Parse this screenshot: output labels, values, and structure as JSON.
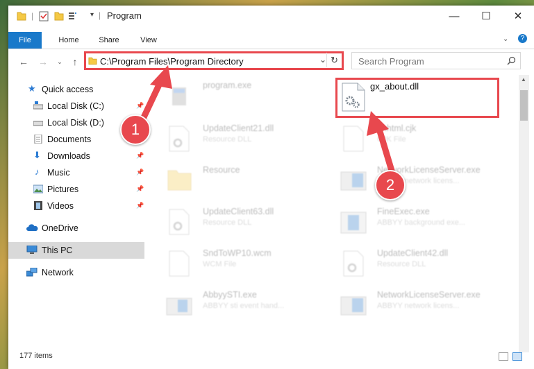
{
  "window": {
    "title": "Program"
  },
  "controls": {
    "minimize": "—",
    "maximize": "☐",
    "close": "✕",
    "help": "?"
  },
  "ribbon": {
    "tabs": [
      {
        "label": "File"
      },
      {
        "label": "Home"
      },
      {
        "label": "Share"
      },
      {
        "label": "View"
      }
    ]
  },
  "address": {
    "path": "C:\\Program Files\\Program Directory"
  },
  "search": {
    "placeholder": "Search Program"
  },
  "sidebar": {
    "items": [
      {
        "label": "Quick access"
      },
      {
        "label": "Local Disk (C:)"
      },
      {
        "label": "Local Disk (D:)"
      },
      {
        "label": "Documents"
      },
      {
        "label": "Downloads"
      },
      {
        "label": "Music"
      },
      {
        "label": "Pictures"
      },
      {
        "label": "Videos"
      },
      {
        "label": "OneDrive"
      },
      {
        "label": "This PC"
      },
      {
        "label": "Network"
      }
    ]
  },
  "files": [
    {
      "name": "program.exe",
      "sub": ""
    },
    {
      "name": "gx_about.dll",
      "sub": ""
    },
    {
      "name": "UpdateClient21.dll",
      "sub": "Resource DLL"
    },
    {
      "name": "unhtml.cjk",
      "sub": "CJK File"
    },
    {
      "name": "Resource",
      "sub": ""
    },
    {
      "name": "NetworkLicenseServer.exe",
      "sub": "ABBYY network licens..."
    },
    {
      "name": "UpdateClient63.dll",
      "sub": "Resource DLL"
    },
    {
      "name": "FineExec.exe",
      "sub": "ABBYY background exe..."
    },
    {
      "name": "SndToWP10.wcm",
      "sub": "WCM File"
    },
    {
      "name": "UpdateClient42.dll",
      "sub": "Resource DLL"
    },
    {
      "name": "AbbyySTI.exe",
      "sub": "ABBYY sti event hand..."
    },
    {
      "name": "NetworkLicenseServer.exe",
      "sub": "ABBYY network licens..."
    }
  ],
  "callouts": {
    "one": "1",
    "two": "2"
  },
  "status": {
    "count": "177 items"
  }
}
